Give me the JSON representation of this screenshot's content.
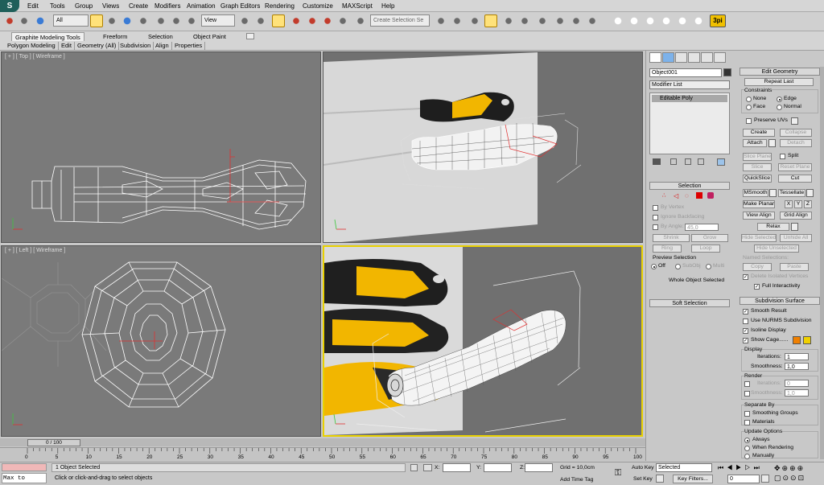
{
  "menu": [
    "Edit",
    "Tools",
    "Group",
    "Views",
    "Create",
    "Modifiers",
    "Animation",
    "Graph Editors",
    "Rendering",
    "Customize",
    "MAXScript",
    "Help"
  ],
  "toolbar": {
    "selection_filter": "All",
    "ref_coord": "View",
    "named_selection_placeholder": "Create Selection Se",
    "plugin_label": "3pi"
  },
  "ribbon": {
    "tabs": [
      "Graphite Modeling Tools",
      "Freeform",
      "Selection",
      "Object Paint"
    ],
    "subtabs": [
      "Polygon Modeling",
      "Edit",
      "Geometry (All)",
      "Subdivision",
      "Align",
      "Properties"
    ]
  },
  "viewports": {
    "top": "[ + ] [ Top ] [ Wireframe ]",
    "persp": "",
    "left": "[ + ] [ Left ] [ Wireframe ]",
    "persp2": ""
  },
  "command_panel": {
    "object_name": "Object001",
    "modifier_list": "Modifier List",
    "stack_item": "Editable Poly",
    "selection": {
      "title": "Selection",
      "by_vertex": "By Vertex",
      "ignore_backfacing": "Ignore Backfacing",
      "by_angle": "By Angle:",
      "angle_value": "45,0",
      "shrink": "Shrink",
      "grow": "Grow",
      "ring": "Ring",
      "loop": "Loop",
      "preview": "Preview Selection",
      "off": "Off",
      "subobj": "SubObj",
      "multi": "Multi",
      "whole": "Whole Object Selected"
    },
    "soft_selection": "Soft Selection",
    "edit_geometry": {
      "title": "Edit Geometry",
      "repeat_last": "Repeat Last",
      "constraints": "Constraints",
      "none": "None",
      "edge": "Edge",
      "face": "Face",
      "normal": "Normal",
      "preserve_uvs": "Preserve UVs",
      "create": "Create",
      "collapse": "Collapse",
      "attach": "Attach",
      "detach": "Detach",
      "slice_plane": "Slice Plane",
      "split": "Split",
      "slice": "Slice",
      "reset_plane": "Reset Plane",
      "quickslice": "QuickSlice",
      "cut": "Cut",
      "msmooth": "MSmooth",
      "tessellate": "Tessellate",
      "make_planar": "Make Planar",
      "x": "X",
      "y": "Y",
      "z": "Z",
      "view_align": "View Align",
      "grid_align": "Grid Align",
      "relax": "Relax",
      "hide_selected": "Hide Selected",
      "unhide_all": "Unhide All",
      "hide_unselected": "Hide Unselected",
      "named_selections": "Named Selections:",
      "copy": "Copy",
      "paste": "Paste",
      "delete_isolated": "Delete Isolated Vertices",
      "full_interactivity": "Full Interactivity"
    },
    "subdivision": {
      "title": "Subdivision Surface",
      "smooth_result": "Smooth Result",
      "use_nurms": "Use NURMS Subdivision",
      "isoline": "Isoline Display",
      "show_cage": "Show Cage......",
      "display": "Display",
      "iterations": "Iterations:",
      "iter_val": "1",
      "smoothness": "Smoothness:",
      "smooth_val": "1,0",
      "render": "Render",
      "r_iterations": "Iterations:",
      "r_iter_val": "0",
      "r_smoothness": "Smoothness:",
      "r_smooth_val": "1,0",
      "separate_by": "Separate By",
      "smoothing_groups": "Smoothing Groups",
      "materials": "Materials",
      "update_options": "Update Options",
      "always": "Always",
      "when_rendering": "When Rendering",
      "manually": "Manually"
    }
  },
  "timeline": {
    "slider": "0 / 100",
    "ticks": [
      "0",
      "5",
      "10",
      "15",
      "20",
      "25",
      "30",
      "35",
      "40",
      "45",
      "50",
      "55",
      "60",
      "65",
      "70",
      "75",
      "80",
      "85",
      "90",
      "95",
      "100"
    ]
  },
  "status": {
    "script_listener": "Max to Physc",
    "objects_selected": "1 Object Selected",
    "prompt": "Click or click-and-drag to select objects",
    "x_label": "X:",
    "y_label": "Y:",
    "z_label": "Z:",
    "grid": "Grid = 10,0cm",
    "add_time_tag": "Add Time Tag",
    "auto_key": "Auto Key",
    "set_key": "Set Key",
    "selected": "Selected",
    "key_filters": "Key Filters...",
    "frame": "0"
  },
  "colors": {
    "viewport_bg": "#7a7a7a",
    "active_border": "#e8d000",
    "cage_orange": "#f08000",
    "cage_yellow": "#f0d000",
    "handle_yellow": "#f2b600"
  }
}
